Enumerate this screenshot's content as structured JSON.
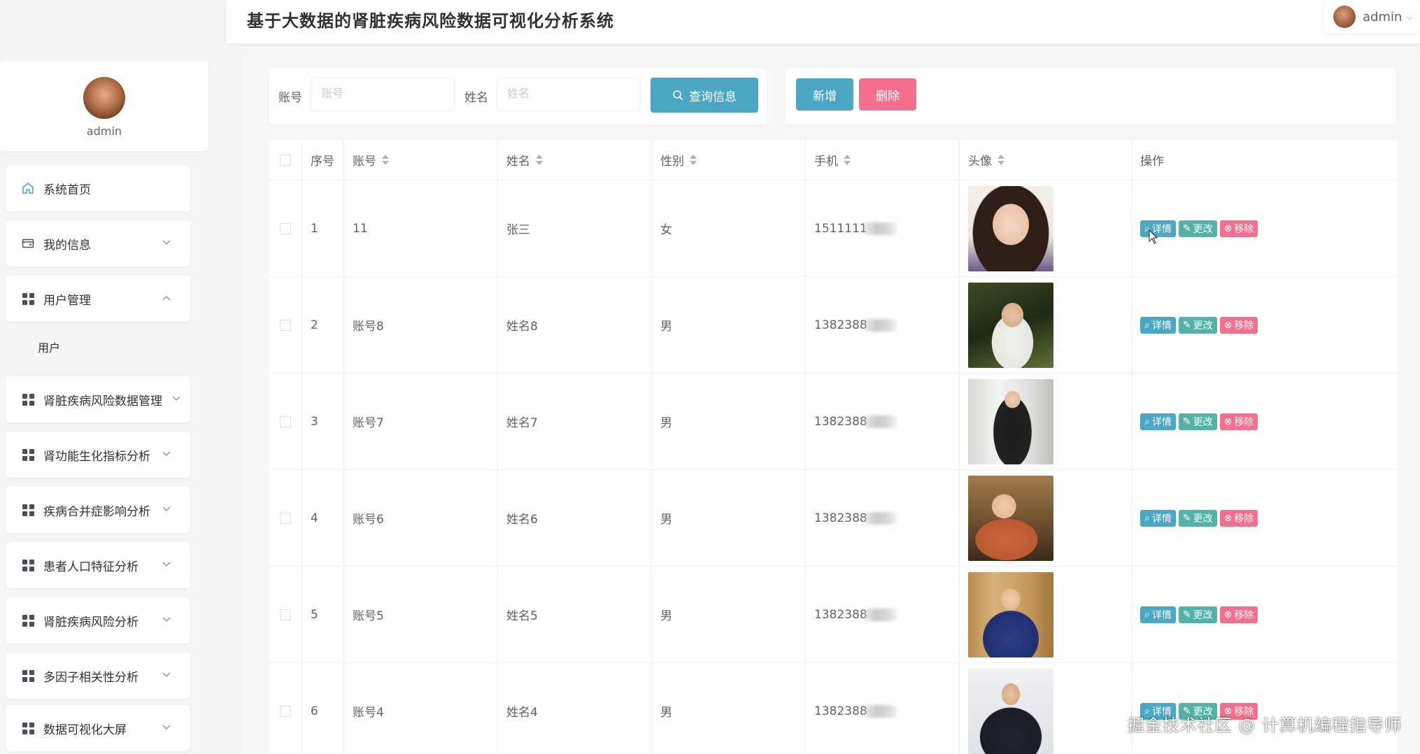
{
  "header": {
    "title": "基于大数据的肾脏疾病风险数据可视化分析系统",
    "user": "admin"
  },
  "sidebar": {
    "profile_name": "admin",
    "items": [
      {
        "label": "系统首页",
        "icon": "home-icon"
      },
      {
        "label": "我的信息",
        "icon": "wallet-icon"
      },
      {
        "label": "用户管理",
        "icon": "grid-icon",
        "expanded": true
      },
      {
        "label": "肾脏疾病风险数据管理",
        "icon": "grid-icon"
      },
      {
        "label": "肾功能生化指标分析",
        "icon": "grid-icon"
      },
      {
        "label": "疾病合并症影响分析",
        "icon": "grid-icon"
      },
      {
        "label": "患者人口特征分析",
        "icon": "grid-icon"
      },
      {
        "label": "肾脏疾病风险分析",
        "icon": "grid-icon"
      },
      {
        "label": "多因子相关性分析",
        "icon": "grid-icon"
      },
      {
        "label": "数据可视化大屏",
        "icon": "grid-icon"
      }
    ],
    "submenu": {
      "label": "用户"
    }
  },
  "search": {
    "account_label": "账号",
    "account_placeholder": "账号",
    "name_label": "姓名",
    "name_placeholder": "姓名",
    "query_label": "查询信息"
  },
  "actions": {
    "add_label": "新增",
    "delete_label": "删除"
  },
  "table": {
    "headers": {
      "index": "序号",
      "account": "账号",
      "name": "姓名",
      "gender": "性别",
      "phone": "手机",
      "avatar": "头像",
      "ops": "操作"
    },
    "rows": [
      {
        "index": "1",
        "account": "11",
        "name": "张三",
        "gender": "女",
        "phone": "1511111"
      },
      {
        "index": "2",
        "account": "账号8",
        "name": "姓名8",
        "gender": "男",
        "phone": "1382388"
      },
      {
        "index": "3",
        "account": "账号7",
        "name": "姓名7",
        "gender": "男",
        "phone": "1382388"
      },
      {
        "index": "4",
        "account": "账号6",
        "name": "姓名6",
        "gender": "男",
        "phone": "1382388"
      },
      {
        "index": "5",
        "account": "账号5",
        "name": "姓名5",
        "gender": "男",
        "phone": "1382388"
      },
      {
        "index": "6",
        "account": "账号4",
        "name": "姓名4",
        "gender": "男",
        "phone": "1382388"
      }
    ],
    "row_actions": {
      "view": "详情",
      "edit": "更改",
      "remove": "移除"
    }
  },
  "watermark": "掘金技术社区 @ 计算机编程指导师",
  "colors": {
    "primary": "#4aa8c5",
    "edit": "#52b3a8",
    "danger": "#f2708e"
  }
}
